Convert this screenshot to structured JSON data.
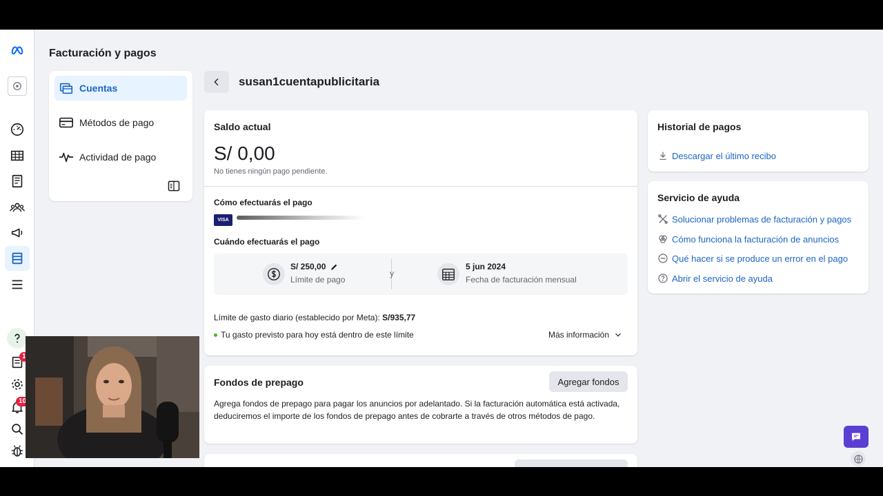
{
  "page": {
    "title": "Facturación y pagos"
  },
  "sidebar": {
    "items": [
      {
        "label": "Cuentas",
        "active": true
      },
      {
        "label": "Métodos de pago",
        "active": false
      },
      {
        "label": "Actividad de pago",
        "active": false
      }
    ]
  },
  "rail": {
    "icons": [
      "meta-logo-icon",
      "account-avatar-icon",
      "dashboard-icon",
      "table-icon",
      "pages-icon",
      "audiences-icon",
      "megaphone-icon",
      "billing-icon",
      "menu-icon",
      "help-icon",
      "notes-icon",
      "settings-icon",
      "bell-icon",
      "search-icon",
      "bug-icon"
    ],
    "notes_badge": "1",
    "bell_badge": "10"
  },
  "account": {
    "name": "susan1cuentapublicitaria"
  },
  "balance": {
    "title": "Saldo actual",
    "amount": "S/ 0,00",
    "subtitle": "No tienes ningún pago pendiente."
  },
  "payment": {
    "how_title": "Cómo efectuarás el pago",
    "card_brand": "VISA",
    "when_title": "Cuándo efectuarás el pago",
    "limit_value": "S/ 250,00",
    "limit_label": "Límite de pago",
    "conjunction": "y",
    "billing_date": "5 jun 2024",
    "billing_label": "Fecha de facturación mensual",
    "daily_limit_label": "Límite de gasto diario (establecido por Meta):",
    "daily_limit_value": "S/935,77",
    "status_text": "Tu gasto previsto para hoy está dentro de este límite",
    "more_info": "Más información"
  },
  "prepaid": {
    "title": "Fondos de prepago",
    "button": "Agregar fondos",
    "description": "Agrega fondos de prepago para pagar los anuncios por adelantado. Si la facturación automática está activada, deduciremos el importe de los fondos de prepago antes de cobrarte a través de otros métodos de pago."
  },
  "history": {
    "title": "Historial de pagos",
    "download": "Descargar el último recibo"
  },
  "help": {
    "title": "Servicio de ayuda",
    "links": [
      "Solucionar problemas de facturación y pagos",
      "Cómo funciona la facturación de anuncios",
      "Qué hacer si se produce un error en el pago",
      "Abrir el servicio de ayuda"
    ]
  },
  "colors": {
    "accent": "#1d65c1",
    "status_green": "#42b72a",
    "chat": "#5b3fd3"
  }
}
